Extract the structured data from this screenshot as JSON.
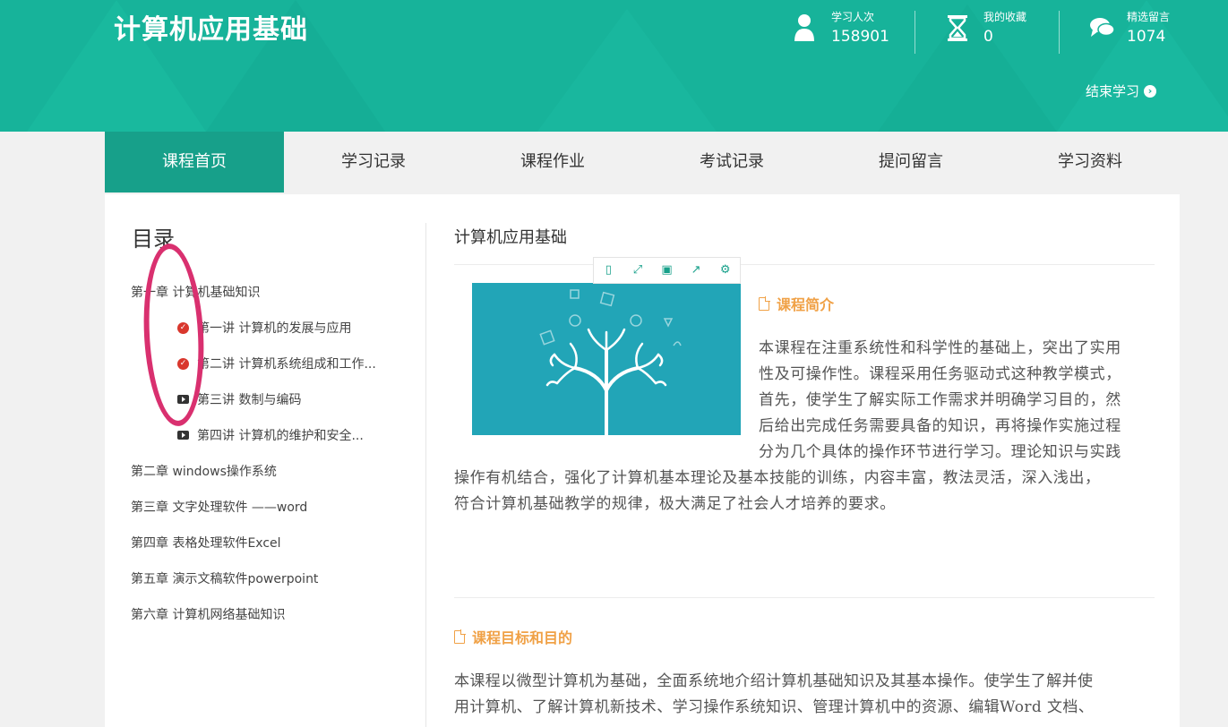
{
  "header": {
    "site_title": "计算机应用基础",
    "stats": [
      {
        "label": "学习人次",
        "value": "158901",
        "icon": "user-icon"
      },
      {
        "label": "我的收藏",
        "value": "0",
        "icon": "hourglass-icon"
      },
      {
        "label": "精选留言",
        "value": "1074",
        "icon": "comments-icon"
      }
    ],
    "end_study": "结束学习",
    "colors": {
      "primary": "#17b39a",
      "active_tab": "#17a08a"
    }
  },
  "tabs": [
    "课程首页",
    "学习记录",
    "课程作业",
    "考试记录",
    "提问留言",
    "学习资料"
  ],
  "toc": {
    "title": "目录",
    "chapters": [
      {
        "label": "第一章 计算机基础知识",
        "lessons": [
          {
            "label": "第一讲 计算机的发展与应用",
            "status": "completed",
            "icon": "check-circle-icon"
          },
          {
            "label": "第二讲 计算机系统组成和工作...",
            "status": "completed",
            "icon": "check-circle-icon"
          },
          {
            "label": "第三讲 数制与编码",
            "status": "video",
            "icon": "video-icon"
          },
          {
            "label": "第四讲 计算机的维护和安全...",
            "status": "video",
            "icon": "video-icon"
          }
        ]
      },
      {
        "label": "第二章 windows操作系统"
      },
      {
        "label": "第三章 文字处理软件 ——word"
      },
      {
        "label": "第四章 表格处理软件Excel"
      },
      {
        "label": "第五章 演示文稿软件powerpoint"
      },
      {
        "label": "第六章 计算机网络基础知识"
      }
    ]
  },
  "content": {
    "course_heading": "计算机应用基础",
    "image_toolbar_icons": [
      "fit-icon",
      "fullscreen-icon",
      "save-icon",
      "share-icon",
      "settings-icon"
    ],
    "intro_section": {
      "title": "课程简介",
      "lines_beside_image": [
        "本课程在注重系统性和科学性的基础上，突出了实用",
        "性及可操作性。课程采用任务驱动式这种教学模式，",
        "首先，使学生了解实际工作需求并明确学习目的，然",
        "后给出完成任务需要具备的知识，再将操作实施过程",
        "分为几个具体的操作环节进行学习。理论知识与实践"
      ],
      "lines_full_width": [
        "操作有机结合，强化了计算机基本理论及基本技能的训练，内容丰富，教法灵活，深入浅出，",
        "符合计算机基础教学的规律，极大满足了社会人才培养的要求。"
      ]
    },
    "goal_section": {
      "title": "课程目标和目的",
      "lines": [
        "本课程以微型计算机为基础，全面系统地介绍计算机基础知识及其基本操作。使学生了解并使",
        "用计算机、了解计算机新技术、学习操作系统知识、管理计算机中的资源、编辑Word 文档、"
      ]
    }
  }
}
